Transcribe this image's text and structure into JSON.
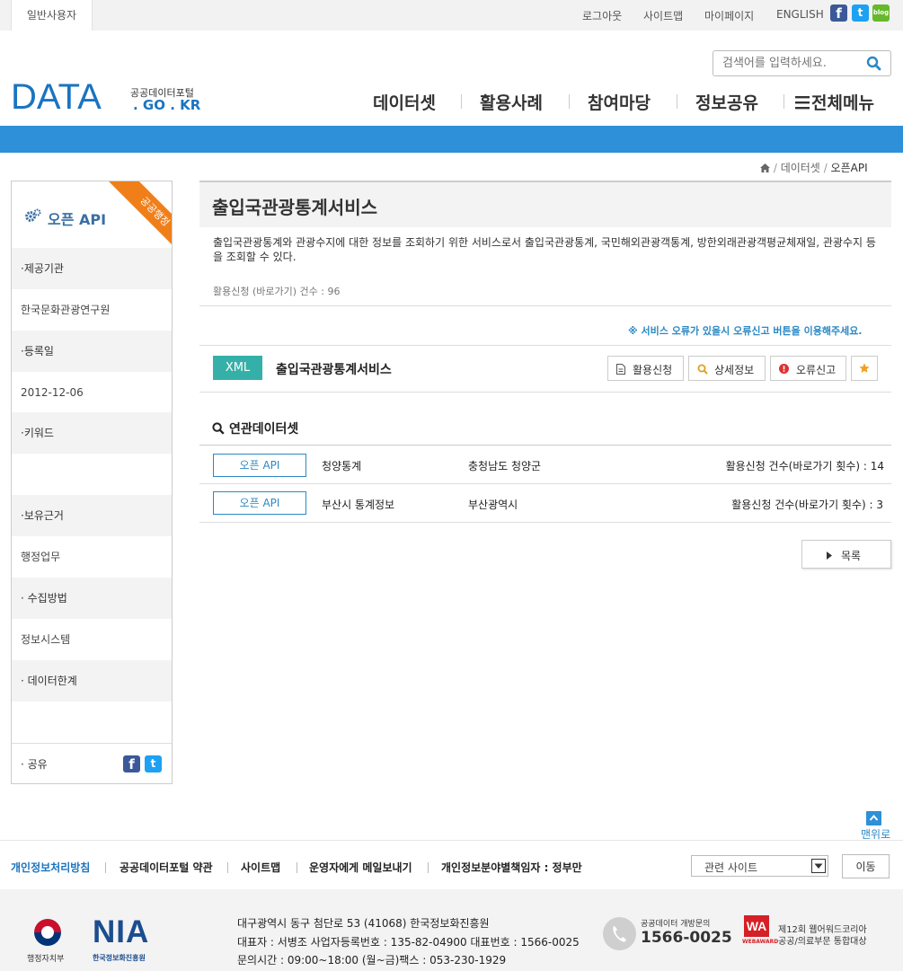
{
  "topbar": {
    "user_tab": "일반사용자",
    "links": [
      "로그아웃",
      "사이트맵",
      "마이페이지",
      "ENGLISH"
    ],
    "social_icons": [
      "facebook-icon",
      "twitter-icon",
      "blog-icon"
    ]
  },
  "header": {
    "logo_main": "DATA",
    "logo_sub1": "공공데이터포털",
    "logo_sub2": ". GO . KR",
    "search_placeholder": "검색어를 입력하세요.",
    "nav": [
      "데이터셋",
      "활용사례",
      "참여마당",
      "정보공유"
    ],
    "all_menu": "전체메뉴"
  },
  "breadcrumb": [
    "데이터셋",
    "오픈API"
  ],
  "sidebar": {
    "title": "오픈 API",
    "ribbon": "공공행정",
    "provider_label": "·제공기관",
    "provider_value": "한국문화관광연구원",
    "regdate_label": "·등록일",
    "regdate_value": "2012-12-06",
    "keyword_label": "·키워드",
    "keyword_value": "",
    "basis_label": "·보유근거",
    "basis_value": "행정업무",
    "method_label": "· 수집방법",
    "method_value": "정보시스템",
    "limit_label": "· 데이터한계",
    "limit_value": "",
    "share_label": "· 공유"
  },
  "main": {
    "title": "출입국관광통계서비스",
    "description": "출입국관광통계와 관광수지에 대한 정보를 조회하기 위한 서비스로서 출입국관광통계, 국민해외관광객통계, 방한외래관광객평균체재일, 관광수지 등을 조회할 수 있다.",
    "usage_count": "활용신청 (바로가기) 건수 : 96",
    "error_notice": "※ 서비스 오류가 있을시 오류신고 버튼을 이용해주세요.",
    "format_tag": "XML",
    "service_name": "출입국관광통계서비스",
    "buttons": {
      "apply": "활용신청",
      "detail": "상세정보",
      "report": "오류신고"
    },
    "related_title": "연관데이터셋",
    "related": [
      {
        "tag": "오픈 API",
        "name": "청양통계",
        "org": "충청남도 청양군",
        "count": "활용신청 건수(바로가기 횟수) : 14"
      },
      {
        "tag": "오픈 API",
        "name": "부산시 통계정보",
        "org": "부산광역시",
        "count": "활용신청 건수(바로가기 횟수) : 3"
      }
    ],
    "list_button": "목록",
    "top_button": "맨위로"
  },
  "footer": {
    "links": [
      "개인정보처리방침",
      "공공데이터포털 약관",
      "사이트맵",
      "운영자에게 메일보내기",
      "개인정보분야별책임자 : 정부만"
    ],
    "related_select": "관련 사이트",
    "go_button": "이동",
    "org1": "행정자치부",
    "org2_logo": "NIA",
    "org2": "한국정보화진흥원",
    "address1": "대구광역시 동구 첨단로 53 (41068) 한국정보화진흥원",
    "address2": "대표자 : 서병조 사업자등록번호 : 135-82-04900 대표번호 : 1566-0025",
    "address3": "문의시간 : 09:00~18:00 (월~금)팩스 : 053-230-1929",
    "phone_label": "공공데이터 개방문의",
    "phone": "1566-0025",
    "award_logo": "WA",
    "award_small": "WEBAWARD",
    "award1": "제12회 웹어워드코리아",
    "award2": "공공/의료부문 통합대상"
  },
  "colors": {
    "brand_blue": "#2e90d8",
    "teal": "#35b0a8",
    "orange": "#f07f1a",
    "link_blue": "#1a74c0"
  }
}
